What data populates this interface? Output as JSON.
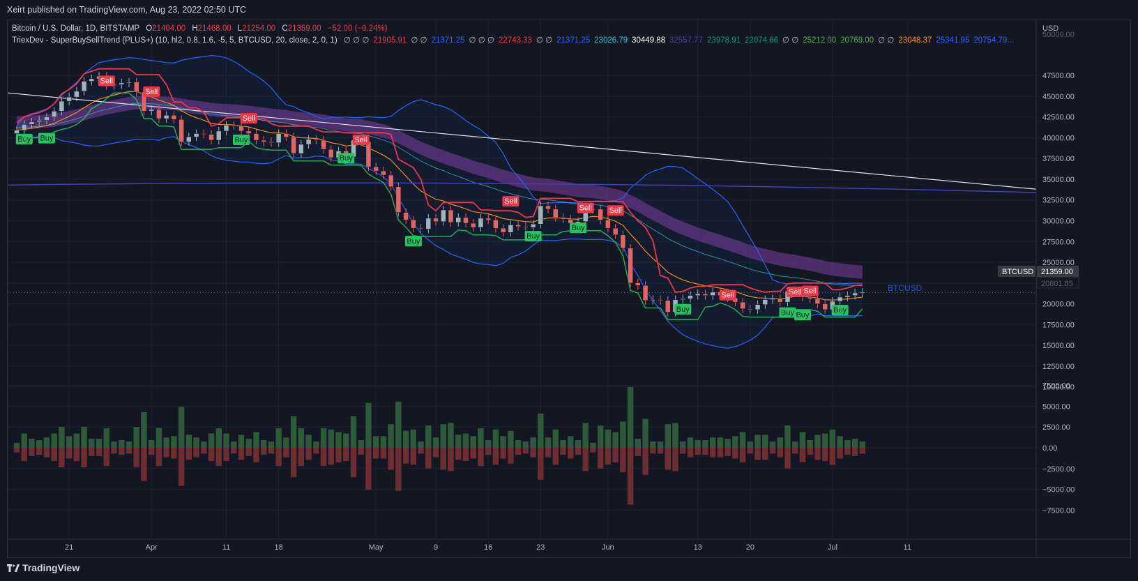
{
  "header": {
    "published_text": "Xeirt published on TradingView.com, Aug 23, 2022 02:50 UTC"
  },
  "legend": {
    "symbol_line": "Bitcoin / U.S. Dollar, 1D, BITSTAMP",
    "ohlc": [
      {
        "label": "O",
        "value": "21404.00"
      },
      {
        "label": "H",
        "value": "21468.00"
      },
      {
        "label": "L",
        "value": "21254.00"
      },
      {
        "label": "C",
        "value": "21359.00"
      }
    ],
    "change": "−52.00 (−0.24%)",
    "indicator_name": "TriexDev - SuperBuySellTrend (PLUS+) (10, hl2, 0.8, 1.6, -5, 5, BTCUSD, 20, close, 2, 0, 1)",
    "indicator_values": [
      {
        "text": "∅ ∅ ∅",
        "color": "#b2b5be"
      },
      {
        "text": "21905.91",
        "color": "#f23645"
      },
      {
        "text": "∅ ∅",
        "color": "#b2b5be"
      },
      {
        "text": "21371.25",
        "color": "#2962ff"
      },
      {
        "text": "∅ ∅ ∅",
        "color": "#b2b5be"
      },
      {
        "text": "22743.33",
        "color": "#f23645"
      },
      {
        "text": "∅ ∅",
        "color": "#b2b5be"
      },
      {
        "text": "21371.25",
        "color": "#2962ff"
      },
      {
        "text": "23026.79",
        "color": "#26c6da"
      },
      {
        "text": "30449.88",
        "color": "#ffffff"
      },
      {
        "text": "32557.77",
        "color": "#4a3f9e"
      },
      {
        "text": "23978.91",
        "color": "#089981"
      },
      {
        "text": "22074.66",
        "color": "#089981"
      },
      {
        "text": "∅ ∅",
        "color": "#b2b5be"
      },
      {
        "text": "25212.00",
        "color": "#4caf50"
      },
      {
        "text": "20769.00",
        "color": "#4caf50"
      },
      {
        "text": "∅ ∅",
        "color": "#b2b5be"
      },
      {
        "text": "23048.37",
        "color": "#ff9800"
      },
      {
        "text": "25341.95",
        "color": "#2962ff"
      },
      {
        "text": "20754.79...",
        "color": "#2962ff"
      }
    ]
  },
  "price_axis": {
    "currency": "USD",
    "last_price_label": "21359.00",
    "symbol_tag": "BTCUSD",
    "secondary_price_label": "20801.85"
  },
  "watermark": "BTCUSD",
  "footer": {
    "brand": "TradingView"
  },
  "colors": {
    "bull": "#9fb3bb",
    "bear": "#e06666",
    "up_volume": "#2e5a3c",
    "down_volume": "#6e2c33",
    "supertrend_down": "#f23645",
    "supertrend_up": "#22c55e",
    "ema_orange": "#ff9800",
    "bollinger": "#2962ff",
    "ma_white": "#e0e3eb",
    "ma_purple": "#3f3fbf",
    "cloud": "#7b3fa0"
  },
  "chart_data": {
    "type": "candlestick",
    "x_tick_labels": [
      {
        "label": "21",
        "date": "2022-03-21"
      },
      {
        "label": "Apr",
        "date": "2022-04-01"
      },
      {
        "label": "11",
        "date": "2022-04-11"
      },
      {
        "label": "18",
        "date": "2022-04-18"
      },
      {
        "label": "May",
        "date": "2022-05-01"
      },
      {
        "label": "9",
        "date": "2022-05-09"
      },
      {
        "label": "16",
        "date": "2022-05-16"
      },
      {
        "label": "23",
        "date": "2022-05-23"
      },
      {
        "label": "Jun",
        "date": "2022-06-01"
      },
      {
        "label": "13",
        "date": "2022-06-13"
      },
      {
        "label": "20",
        "date": "2022-06-20"
      },
      {
        "label": "Jul",
        "date": "2022-07-01"
      },
      {
        "label": "11",
        "date": "2022-07-11"
      }
    ],
    "price_ticks": [
      "47500.00",
      "45000.00",
      "42500.00",
      "40000.00",
      "37500.00",
      "35000.00",
      "32500.00",
      "30000.00",
      "27500.00",
      "25000.00",
      "22500.00",
      "20000.00",
      "17500.00",
      "15000.00",
      "12500.00",
      "10000.00",
      "7500.00",
      "5000.00",
      "2500.00",
      "0.00",
      "−2500.00",
      "−5000.00",
      "−7500.00"
    ],
    "price_axis_top_partial": "50000.00",
    "ylim_price": [
      10000,
      50000
    ],
    "ylim_volume": [
      -8000,
      8000
    ],
    "grid": true,
    "candles_close": [
      40900,
      41600,
      41900,
      42100,
      42500,
      43200,
      44400,
      44900,
      45600,
      46800,
      47100,
      47400,
      46300,
      46400,
      46600,
      46700,
      45500,
      43200,
      43400,
      42300,
      42700,
      42200,
      39500,
      40100,
      40500,
      40400,
      39700,
      40800,
      41500,
      41400,
      40800,
      40500,
      39700,
      39500,
      39400,
      40500,
      40100,
      38100,
      39200,
      39800,
      39700,
      38600,
      37600,
      38400,
      37700,
      39700,
      39500,
      36500,
      36000,
      35500,
      34100,
      31000,
      30100,
      29100,
      29000,
      30300,
      29900,
      31300,
      29800,
      30400,
      29700,
      29200,
      30300,
      30100,
      29100,
      28600,
      29500,
      29300,
      29200,
      29600,
      31800,
      31400,
      30400,
      30200,
      29700,
      29900,
      31400,
      31400,
      30100,
      29100,
      28300,
      26700,
      22500,
      22200,
      20400,
      20500,
      20400,
      19000,
      20500,
      20600,
      21000,
      21200,
      21000,
      21400,
      21000,
      20700,
      20200,
      19400,
      19300,
      19900,
      20500,
      20600,
      20200,
      21500,
      21600,
      20800,
      20600,
      20000,
      19300,
      20300,
      20800,
      21000,
      21300,
      21400
    ],
    "series": [
      {
        "name": "Sell",
        "type": "signal",
        "values": [
          46800,
          45500,
          42300,
          39700,
          32300,
          31500,
          31200,
          21000,
          21400,
          21500
        ]
      },
      {
        "name": "Buy",
        "type": "signal",
        "values": [
          39800,
          39900,
          39700,
          37500,
          27500,
          28100,
          29100,
          19300,
          18900,
          18600,
          19200
        ]
      }
    ],
    "volume_delta_range": [
      -8000,
      8500
    ]
  }
}
